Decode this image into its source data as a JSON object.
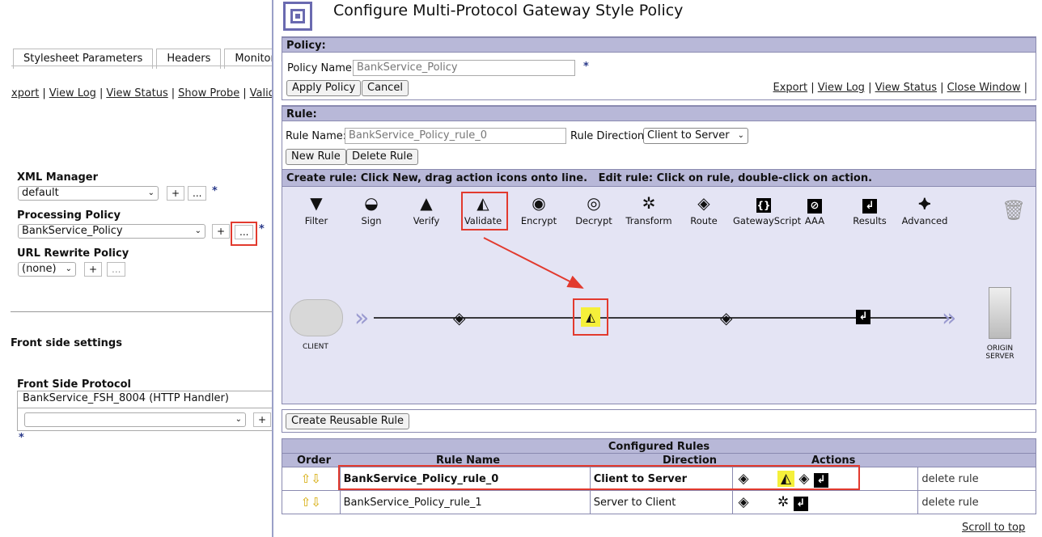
{
  "background": {
    "tabs": [
      "Stylesheet Parameters",
      "Headers",
      "Monitors"
    ],
    "links": [
      "xport",
      "View Log",
      "View Status",
      "Show Probe",
      "Validate"
    ],
    "xml_manager": {
      "label": "XML Manager",
      "value": "default"
    },
    "processing_policy": {
      "label": "Processing Policy",
      "value": "BankService_Policy"
    },
    "url_rewrite": {
      "label": "URL Rewrite Policy",
      "value": "(none)"
    },
    "front_side_settings": "Front side settings",
    "front_side_protocol": {
      "label": "Front Side Protocol",
      "value": "BankService_FSH_8004 (HTTP Handler)",
      "select_value": ""
    },
    "plus": "+",
    "ellipsis": "...",
    "required": "*"
  },
  "dialog": {
    "title": "Configure Multi-Protocol Gateway Style Policy",
    "policy": {
      "header": "Policy:",
      "name_label": "Policy Name:",
      "name_value": "BankService_Policy",
      "apply": "Apply Policy",
      "cancel": "Cancel",
      "links": [
        "Export",
        "View Log",
        "View Status",
        "Close Window"
      ]
    },
    "rule": {
      "header": "Rule:",
      "name_label": "Rule Name:",
      "name_value": "BankService_Policy_rule_0",
      "direction_label": "Rule Direction:",
      "direction_value": "Client to Server",
      "new_rule": "New Rule",
      "delete_rule": "Delete Rule",
      "instructions": "Create rule: Click New, drag action icons onto line.   Edit rule: Click on rule, double-click on action."
    },
    "palette": [
      "Filter",
      "Sign",
      "Verify",
      "Validate",
      "Encrypt",
      "Decrypt",
      "Transform",
      "Route",
      "GatewayScript",
      "AAA",
      "Results",
      "Advanced"
    ],
    "canvas": {
      "client": "CLIENT",
      "origin_line1": "ORIGIN",
      "origin_line2": "SERVER"
    },
    "reusable": "Create Reusable Rule",
    "configured": {
      "title": "Configured Rules",
      "columns": [
        "Order",
        "Rule Name",
        "Direction",
        "Actions"
      ],
      "rows": [
        {
          "name": "BankService_Policy_rule_0",
          "direction": "Client to Server",
          "delete": "delete rule"
        },
        {
          "name": "BankService_Policy_rule_1",
          "direction": "Server to Client",
          "delete": "delete rule"
        }
      ]
    },
    "scroll_top": "Scroll to top"
  },
  "colors": {
    "accent": "#b8b8d8",
    "highlight": "#e23a2e",
    "selected": "#f5f03a"
  }
}
